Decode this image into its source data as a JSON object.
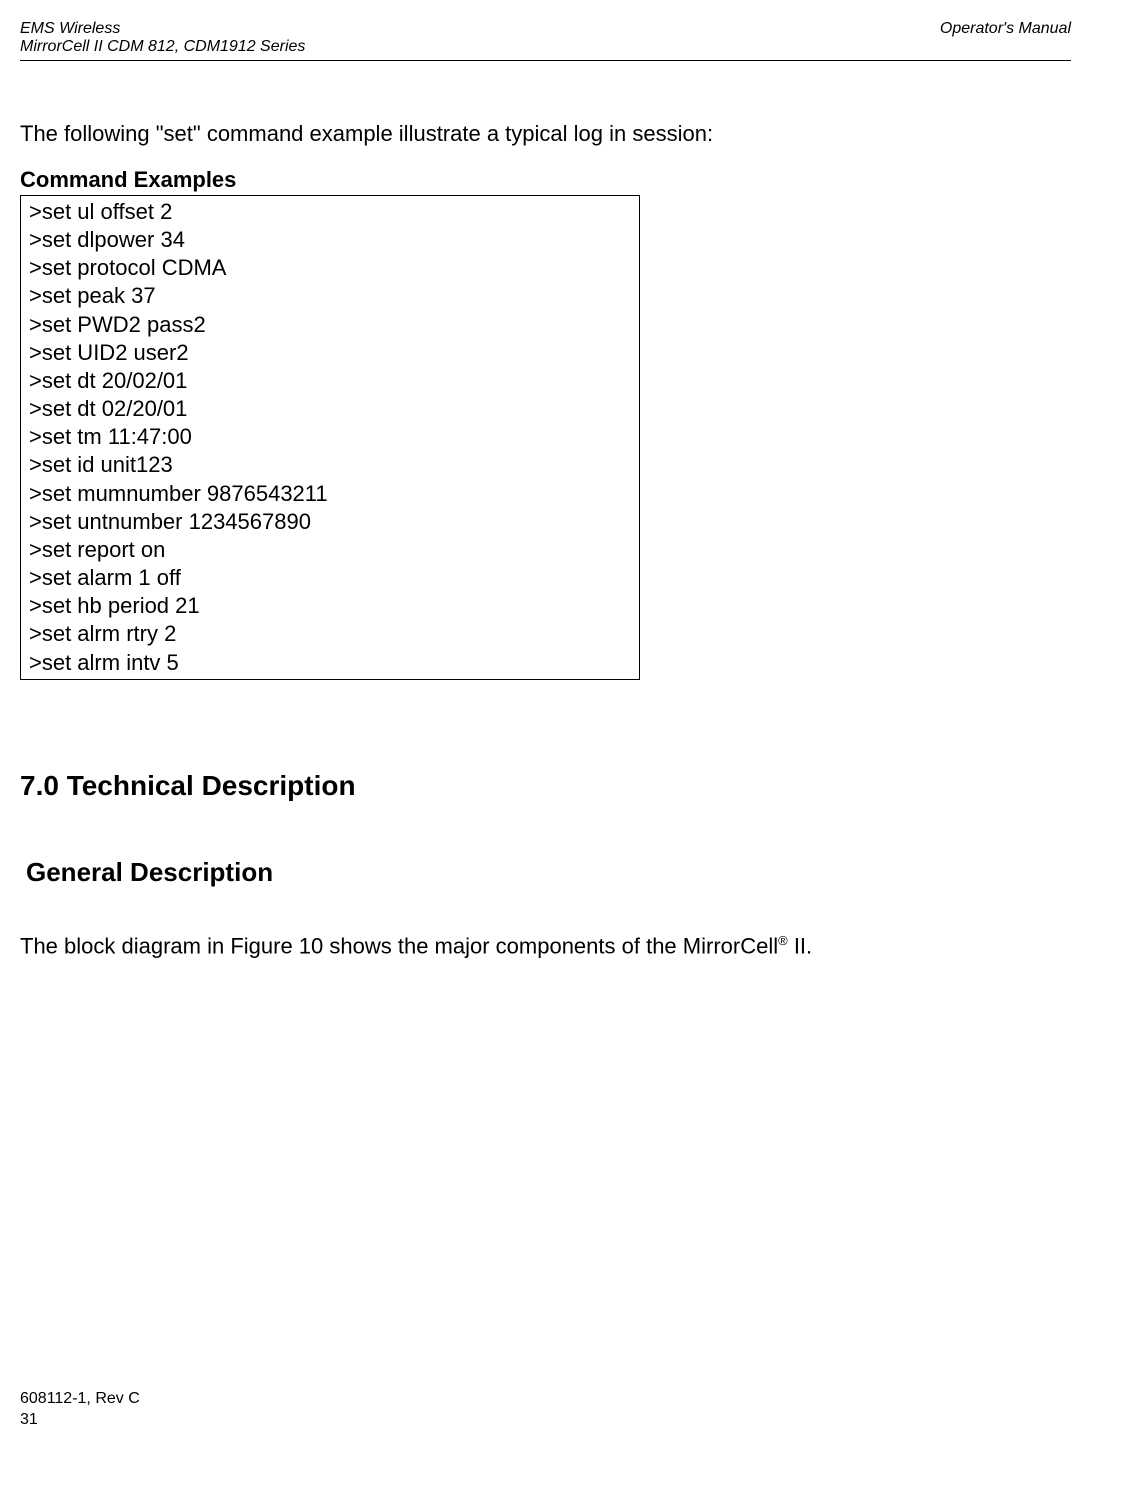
{
  "header": {
    "left_line1": "EMS Wireless",
    "left_line2": "MirrorCell II CDM 812, CDM1912 Series",
    "right": "Operator's Manual"
  },
  "intro": "The following \"set\" command example illustrate a typical log in session:",
  "commands_title": "Command Examples",
  "commands": [
    ">set ul offset 2",
    ">set dlpower 34",
    ">set protocol CDMA",
    ">set peak 37",
    ">set PWD2 pass2",
    ">set UID2 user2",
    ">set dt 20/02/01",
    ">set dt 02/20/01",
    ">set tm 11:47:00",
    ">set id unit123",
    ">set mumnumber 9876543211",
    ">set untnumber 1234567890",
    ">set report on",
    ">set alarm 1 off",
    ">set hb period 21",
    ">set alrm rtry 2",
    ">set alrm intv 5"
  ],
  "section7_title": "7.0  Technical Description",
  "general_title": "General Description",
  "block_diagram_pre": "The block diagram in Figure 10 shows the major components of the MirrorCell",
  "block_diagram_sup": "®",
  "block_diagram_post": " II.",
  "footer": {
    "rev": "608112-1, Rev C",
    "page": "31"
  }
}
